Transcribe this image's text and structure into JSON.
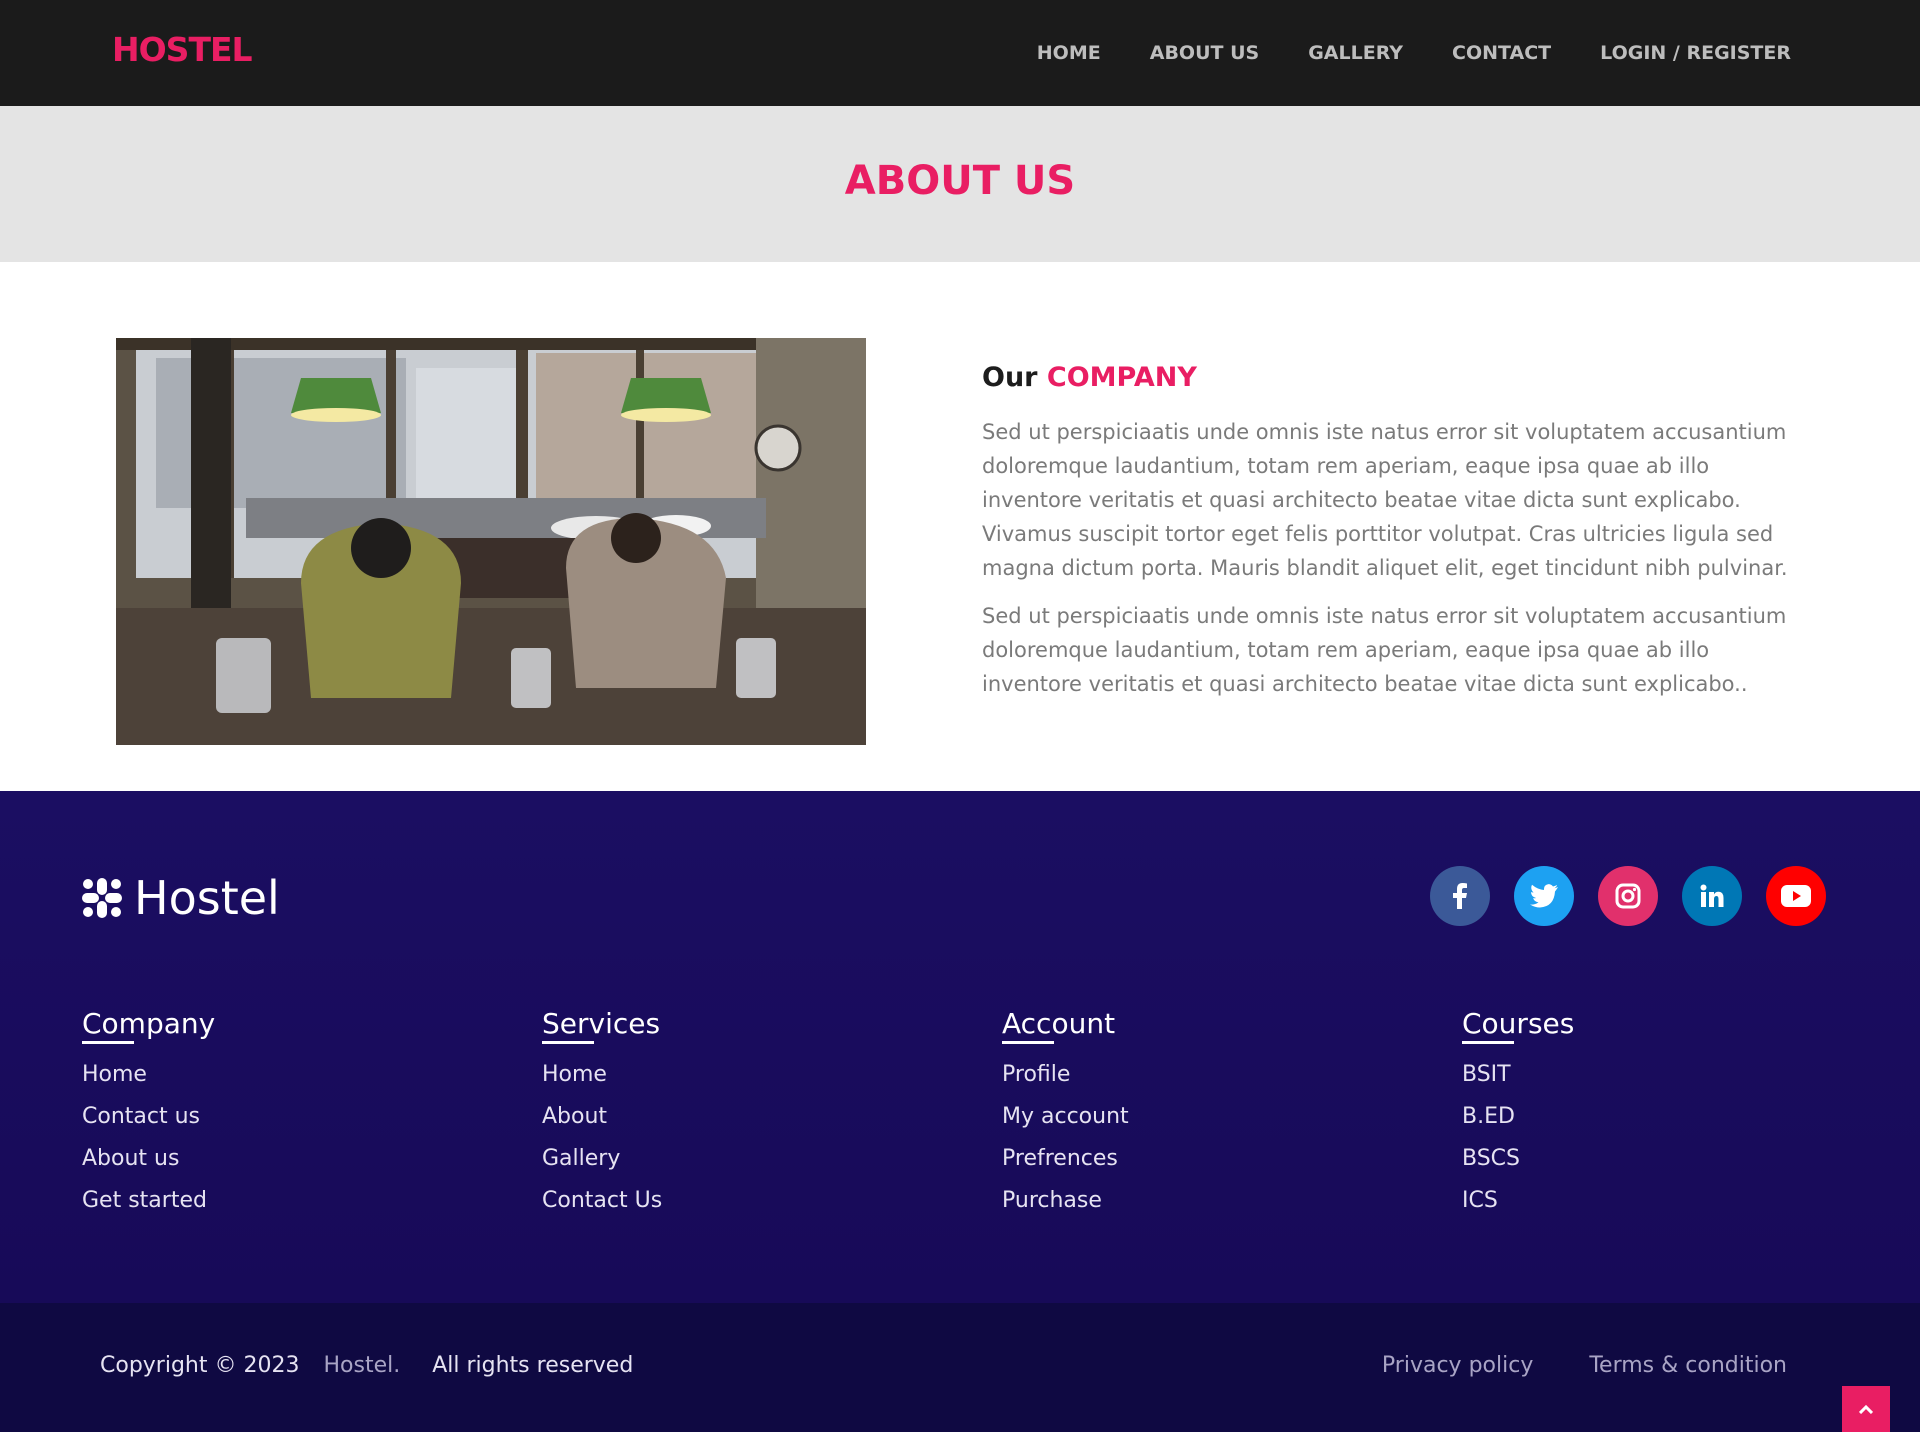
{
  "navbar": {
    "brand": "HOSTEL",
    "links": [
      "HOME",
      "ABOUT US",
      "GALLERY",
      "CONTACT",
      "LOGIN / REGISTER"
    ]
  },
  "page_header": {
    "title": "ABOUT US"
  },
  "about": {
    "heading_prefix": "Our",
    "heading_accent": "COMPANY",
    "paragraphs": [
      "Sed ut perspiciaatis unde omnis iste natus error sit voluptatem accusantium doloremque laudantium, totam rem aperiam, eaque ipsa quae ab illo inventore veritatis et quasi architecto beatae vitae dicta sunt explicabo. Vivamus suscipit tortor eget felis porttitor volutpat. Cras ultricies ligula sed magna dictum porta. Mauris blandit aliquet elit, eget tincidunt nibh pulvinar.",
      "Sed ut perspiciaatis unde omnis iste natus error sit voluptatem accusantium doloremque laudantium, totam rem aperiam, eaque ipsa quae ab illo inventore veritatis et quasi architecto beatae vitae dicta sunt explicabo.."
    ],
    "image_icon": "hostel-lounge-photo"
  },
  "footer": {
    "logo_text": "Hostel",
    "logo_icon": "slack-logo-icon",
    "socials": [
      {
        "name": "facebook-icon",
        "color": "#3b5998"
      },
      {
        "name": "twitter-icon",
        "color": "#1da1f2"
      },
      {
        "name": "instagram-icon",
        "color": "#e1306c"
      },
      {
        "name": "linkedin-icon",
        "color": "#0077b5"
      },
      {
        "name": "youtube-icon",
        "color": "#ff0000"
      }
    ],
    "columns": [
      {
        "title": "Company",
        "links": [
          "Home",
          "Contact us",
          "About us",
          "Get started"
        ]
      },
      {
        "title": "Services",
        "links": [
          "Home",
          "About",
          "Gallery",
          "Contact Us"
        ]
      },
      {
        "title": "Account",
        "links": [
          "Profile",
          "My account",
          "Prefrences",
          "Purchase"
        ]
      },
      {
        "title": "Courses",
        "links": [
          "BSIT",
          "B.ED",
          "BSCS",
          "ICS"
        ]
      }
    ]
  },
  "bottom_bar": {
    "copyright": "Copyright © 2023",
    "brand": "Hostel.",
    "rights": "All rights reserved",
    "privacy": "Privacy policy",
    "terms": "Terms & condition"
  },
  "colors": {
    "accent": "#e91e63",
    "navbar_bg": "#1b1b1b",
    "footer_bg": "#1b0e62",
    "bottom_bg": "#0f0942"
  }
}
